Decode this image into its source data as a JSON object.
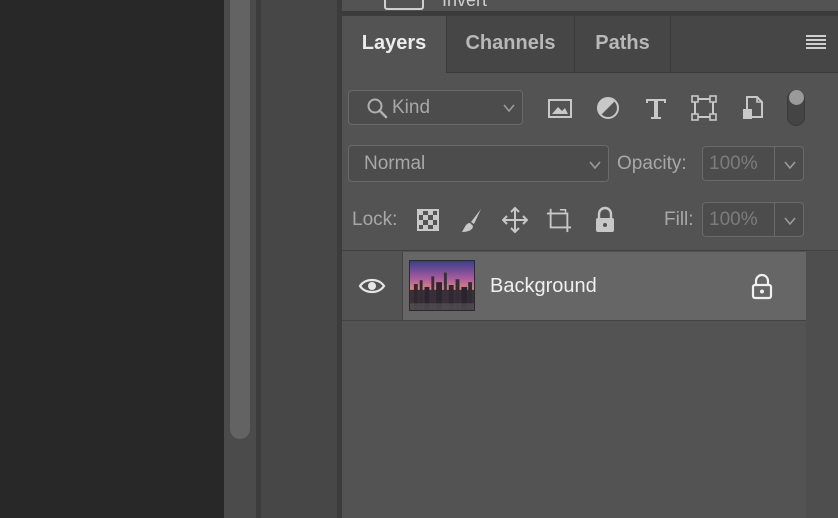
{
  "previous_panel": {
    "label": "Invert"
  },
  "tabs": [
    {
      "label": "Layers",
      "active": true
    },
    {
      "label": "Channels",
      "active": false
    },
    {
      "label": "Paths",
      "active": false
    }
  ],
  "filter": {
    "kind_label": "Kind",
    "icons": [
      "pixel-layer-filter-icon",
      "adjustment-layer-filter-icon",
      "type-layer-filter-icon",
      "shape-layer-filter-icon",
      "smart-object-filter-icon"
    ]
  },
  "blend": {
    "mode": "Normal",
    "opacity_label": "Opacity:",
    "opacity_value": "100%"
  },
  "lock": {
    "label": "Lock:",
    "icons": [
      "lock-transparent-pixels-icon",
      "lock-image-pixels-icon",
      "lock-position-icon",
      "lock-artboard-icon",
      "lock-all-icon"
    ],
    "fill_label": "Fill:",
    "fill_value": "100%"
  },
  "layers": [
    {
      "name": "Background",
      "visible": true,
      "locked": true
    }
  ],
  "colors": {
    "panel_bg": "#535353",
    "selected_row": "#666666",
    "canvas_bg": "#282828"
  }
}
